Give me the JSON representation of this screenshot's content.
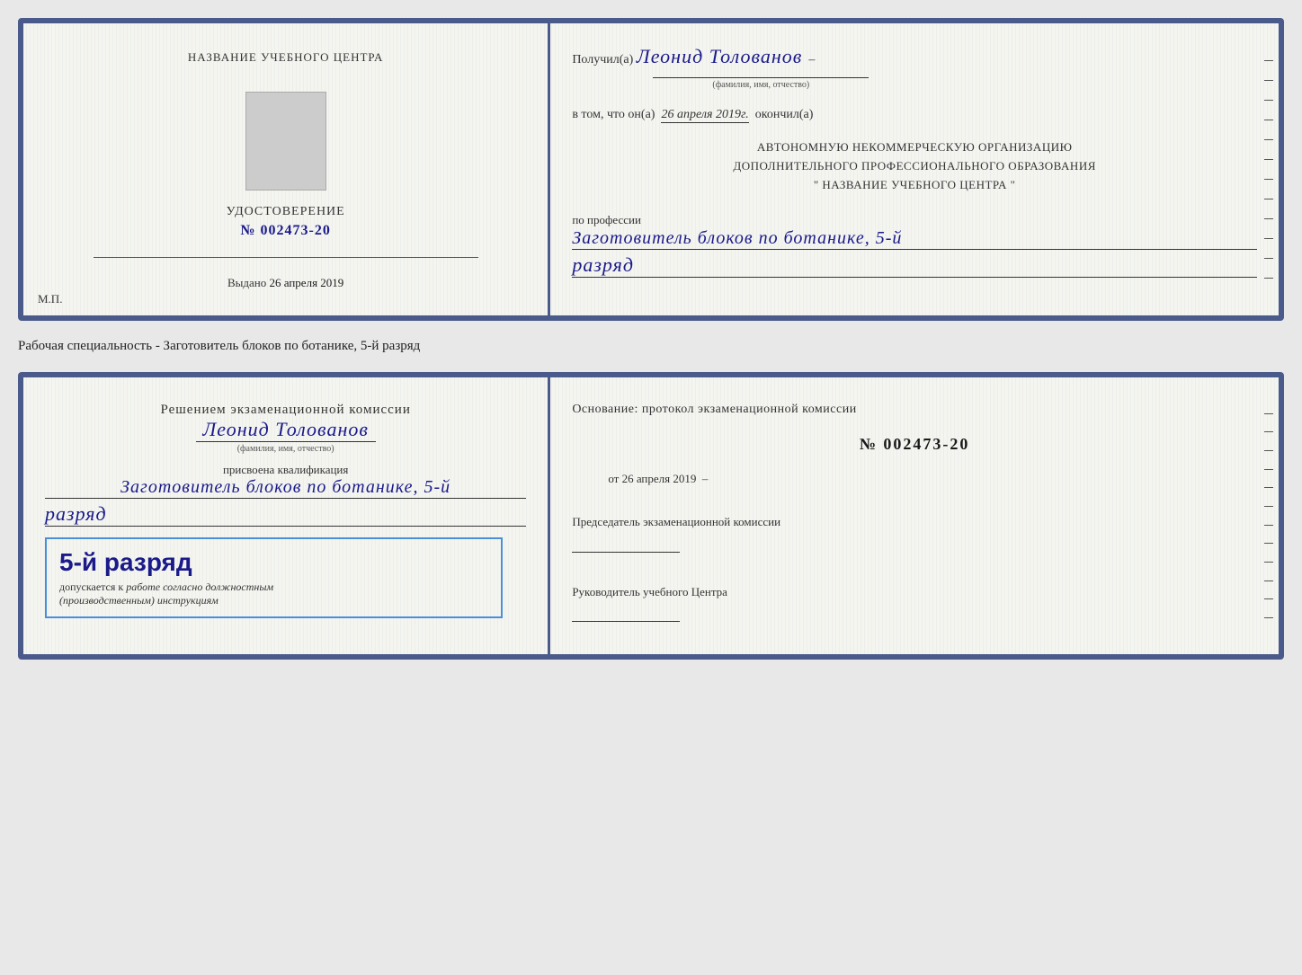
{
  "page": {
    "background": "#e8e8e8"
  },
  "card1": {
    "left": {
      "training_center_label": "НАЗВАНИЕ УЧЕБНОГО ЦЕНТРА",
      "cert_title": "УДОСТОВЕРЕНИЕ",
      "cert_number_prefix": "№",
      "cert_number": "002473-20",
      "issued_label": "Выдано",
      "issued_date": "26 апреля 2019",
      "mp_label": "М.П."
    },
    "right": {
      "received_prefix": "Получил(а)",
      "recipient_name": "Леонид Толованов",
      "fio_label": "(фамилия, имя, отчество)",
      "vtom_text": "в том, что он(а)",
      "vtom_date": "26 апреля 2019г.",
      "okonchil": "окончил(а)",
      "org_line1": "АВТОНОМНУЮ НЕКОММЕРЧЕСКУЮ ОРГАНИЗАЦИЮ",
      "org_line2": "ДОПОЛНИТЕЛЬНОГО ПРОФЕССИОНАЛЬНОГО ОБРАЗОВАНИЯ",
      "org_line3": "\"  НАЗВАНИЕ УЧЕБНОГО ЦЕНТРА  \"",
      "profession_label": "по профессии",
      "profession_value": "Заготовитель блоков по ботанике, 5-й",
      "razryad_value": "разряд"
    }
  },
  "specialty_label": "Рабочая специальность - Заготовитель блоков по ботанике, 5-й разряд",
  "card2": {
    "left": {
      "commission_intro": "Решением экзаменационной комиссии",
      "name": "Леонид Толованов",
      "fio_label": "(фамилия, имя, отчество)",
      "assigned_label": "присвоена квалификация",
      "profession_value": "Заготовитель блоков по ботанике, 5-й",
      "razryad_value": "разряд",
      "stamp_grade": "5-й разряд",
      "stamp_line1": "допускается к",
      "stamp_line2_italic": "работе согласно должностным",
      "stamp_line3_italic": "(производственным) инструкциям"
    },
    "right": {
      "osnov_text": "Основание: протокол экзаменационной комиссии",
      "prot_number": "№  002473-20",
      "ot_label": "от",
      "ot_date": "26 апреля 2019",
      "chairman_title": "Председатель экзаменационной комиссии",
      "head_title": "Руководитель учебного Центра"
    }
  }
}
